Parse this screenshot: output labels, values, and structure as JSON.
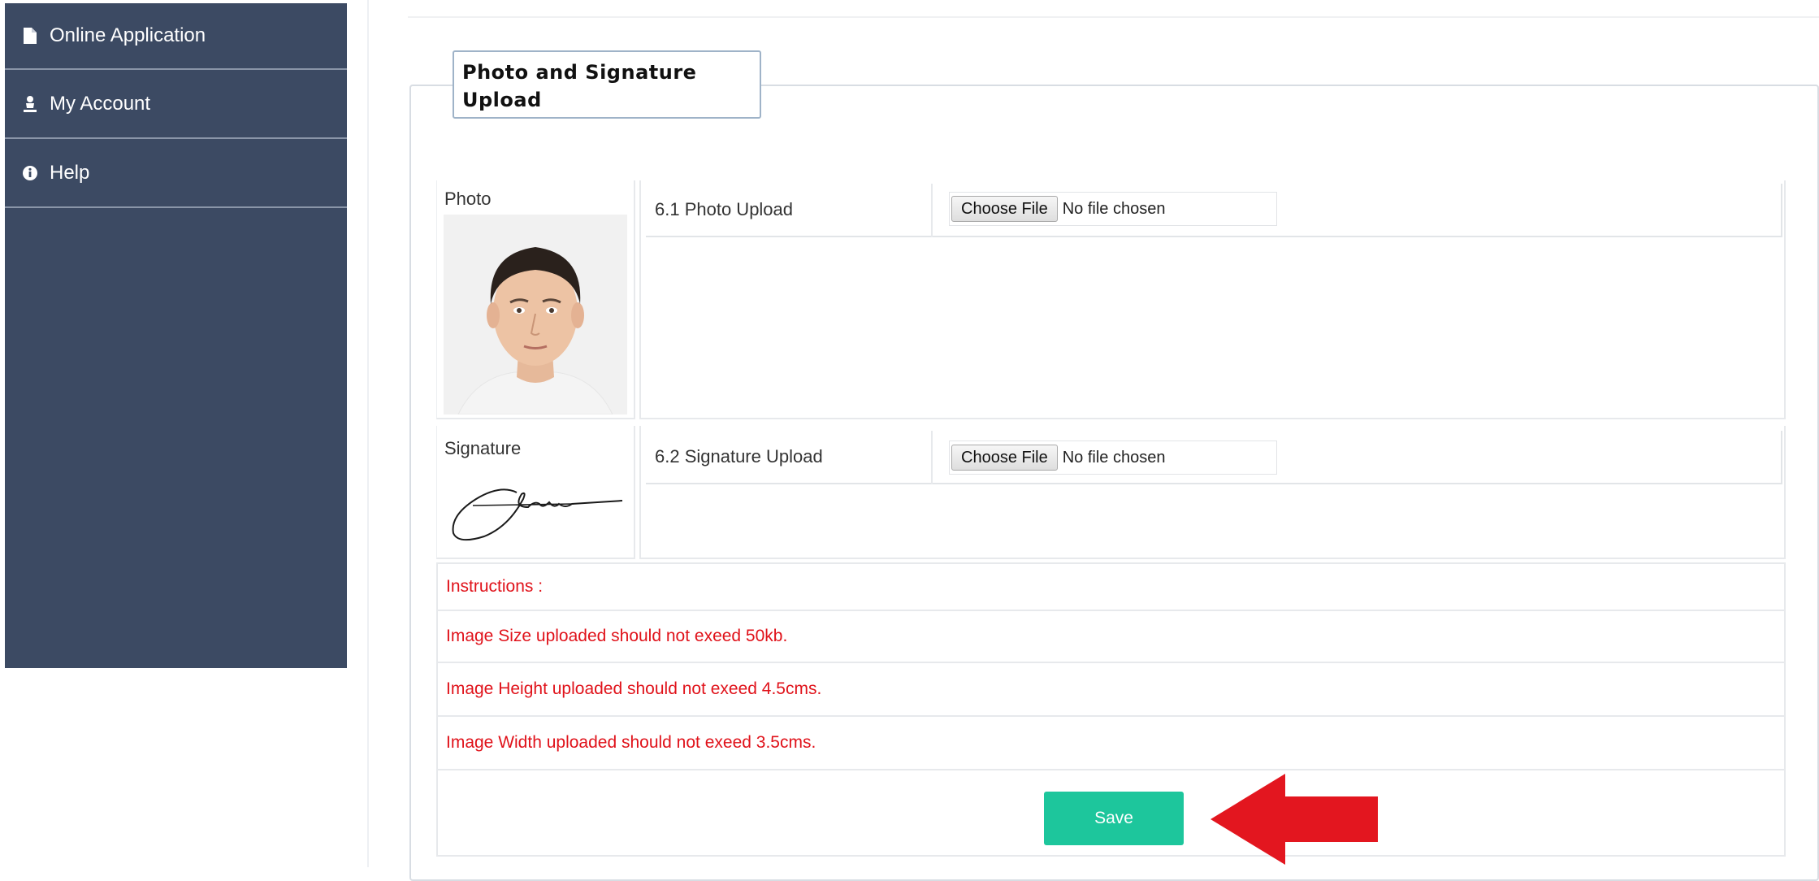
{
  "sidebar": {
    "items": [
      {
        "label": "Online Application",
        "icon": "file-icon"
      },
      {
        "label": "My Account",
        "icon": "user-icon"
      },
      {
        "label": "Help",
        "icon": "info-icon"
      }
    ]
  },
  "panel": {
    "legend": "Photo and Signature Upload"
  },
  "photo": {
    "label": "Photo",
    "field_label": "6.1 Photo Upload",
    "button_label": "Choose File",
    "file_status": "No file chosen"
  },
  "signature": {
    "label": "Signature",
    "field_label": "6.2 Signature Upload",
    "button_label": "Choose File",
    "file_status": "No file chosen"
  },
  "instructions": [
    "Instructions :",
    "Image Size uploaded should not exeed 50kb.",
    "Image Height uploaded should not exeed 4.5cms.",
    "Image Width uploaded should not exeed 3.5cms."
  ],
  "actions": {
    "save_label": "Save"
  },
  "colors": {
    "sidebar_bg": "#3c4a63",
    "instruction_text": "#e0121a",
    "save_button": "#1dc69c",
    "arrow": "#e3161f"
  }
}
